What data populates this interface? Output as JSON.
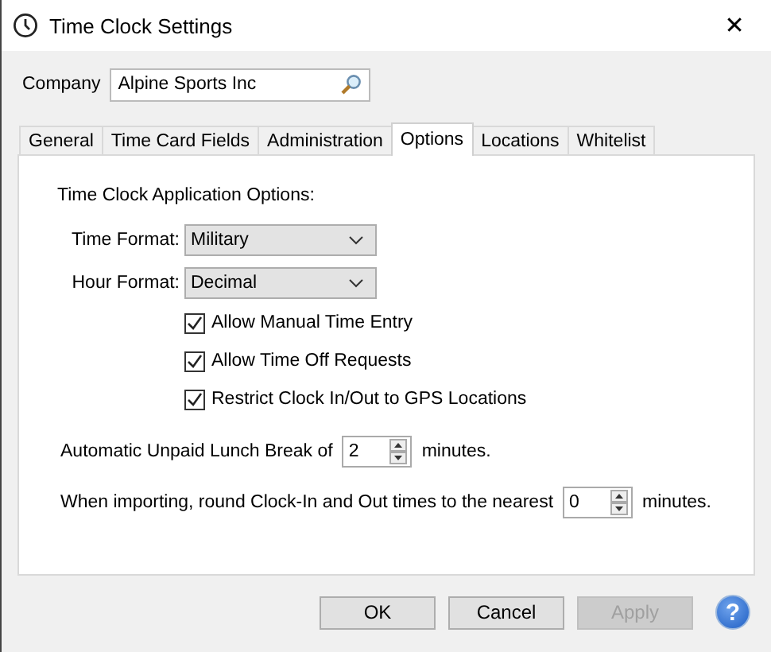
{
  "window": {
    "title": "Time Clock Settings",
    "close": "✕"
  },
  "company": {
    "label": "Company",
    "value": "Alpine Sports Inc"
  },
  "tabs": [
    {
      "label": "General",
      "selected": false
    },
    {
      "label": "Time Card Fields",
      "selected": false
    },
    {
      "label": "Administration",
      "selected": false
    },
    {
      "label": "Options",
      "selected": true
    },
    {
      "label": "Locations",
      "selected": false
    },
    {
      "label": "Whitelist",
      "selected": false
    }
  ],
  "options": {
    "heading": "Time Clock Application Options:",
    "dropdowns": [
      {
        "label": "Time Format:",
        "value": "Military"
      },
      {
        "label": "Hour Format:",
        "value": "Decimal"
      }
    ],
    "checkboxes": [
      {
        "label": "Allow Manual Time Entry",
        "checked": true
      },
      {
        "label": "Allow Time Off Requests",
        "checked": true
      },
      {
        "label": "Restrict Clock In/Out to GPS Locations",
        "checked": true
      }
    ],
    "spinners": [
      {
        "label": "Automatic Unpaid Lunch Break of",
        "value": "2",
        "unit": "minutes."
      },
      {
        "label": "When importing, round Clock-In and Out times to the nearest",
        "value": "0",
        "unit": "minutes."
      }
    ]
  },
  "buttons": [
    {
      "label": "OK",
      "disabled": false
    },
    {
      "label": "Cancel",
      "disabled": false
    },
    {
      "label": "Apply",
      "disabled": true
    }
  ],
  "help": "?"
}
